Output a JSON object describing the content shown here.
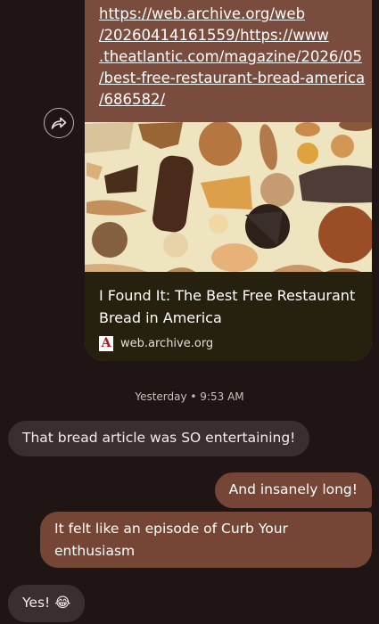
{
  "link_message": {
    "url_lines": [
      "https://web.archive.org/web",
      "/20260414161559/https://www",
      ".theatlantic.com/magazine/2026/05",
      "/best-free-restaurant-bread-america",
      "/686582/"
    ],
    "preview_title": "I Found It: The Best Free Restaurant Bread in America",
    "source_icon_letter": "A",
    "source_domain": "web.archive.org"
  },
  "share_icon": "share-forward-icon",
  "timestamp": "Yesterday • 9:53 AM",
  "messages": [
    {
      "direction": "incoming",
      "text": "That bread article was SO entertaining!"
    },
    {
      "direction": "outgoing",
      "text": "And insanely long!"
    },
    {
      "direction": "outgoing",
      "text": "It felt like an episode of Curb Your enthusiasm"
    },
    {
      "direction": "incoming",
      "text": "Yes! 😂"
    }
  ],
  "colors": {
    "background": "#1f1515",
    "outgoing_bubble": "#754535",
    "incoming_bubble": "#3a2e2e",
    "preview_card": "#26200f"
  }
}
